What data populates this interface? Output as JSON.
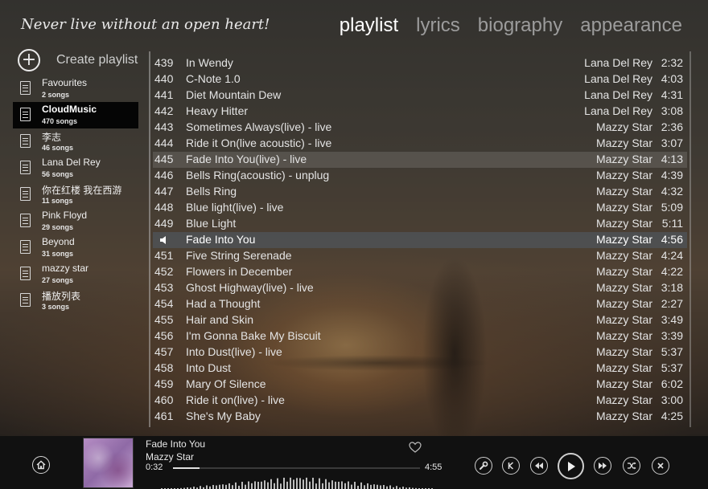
{
  "motto": "Never live without an open heart!",
  "tabs": [
    {
      "label": "playlist",
      "active": true
    },
    {
      "label": "lyrics",
      "active": false
    },
    {
      "label": "biography",
      "active": false
    },
    {
      "label": "appearance",
      "active": false
    }
  ],
  "create_playlist": "Create playlist",
  "playlists": [
    {
      "name": "Favourites",
      "count": "2 songs"
    },
    {
      "name": "CloudMusic",
      "count": "470 songs",
      "active": true
    },
    {
      "name": "李志",
      "count": "46 songs"
    },
    {
      "name": "Lana Del Rey",
      "count": "56 songs"
    },
    {
      "name": "你在红楼 我在西游",
      "count": "11 songs"
    },
    {
      "name": "Pink Floyd",
      "count": "29 songs"
    },
    {
      "name": "Beyond",
      "count": "31 songs"
    },
    {
      "name": "mazzy star",
      "count": "27 songs"
    },
    {
      "name": "播放列表",
      "count": "3 songs"
    }
  ],
  "tracks": [
    {
      "num": "439",
      "title": "In Wendy",
      "artist": "Lana Del Rey",
      "duration": "2:32"
    },
    {
      "num": "440",
      "title": "C-Note 1.0",
      "artist": "Lana Del Rey",
      "duration": "4:03"
    },
    {
      "num": "441",
      "title": "Diet Mountain Dew",
      "artist": "Lana Del Rey",
      "duration": "4:31"
    },
    {
      "num": "442",
      "title": "Heavy Hitter",
      "artist": "Lana Del Rey",
      "duration": "3:08"
    },
    {
      "num": "443",
      "title": "Sometimes Always(live) - live",
      "artist": "Mazzy Star",
      "duration": "2:36"
    },
    {
      "num": "444",
      "title": "Ride it On(live acoustic) - live",
      "artist": "Mazzy Star",
      "duration": "3:07"
    },
    {
      "num": "445",
      "title": "Fade Into You(live) - live",
      "artist": "Mazzy Star",
      "duration": "4:13",
      "selected": true
    },
    {
      "num": "446",
      "title": "Bells Ring(acoustic) - unplug",
      "artist": "Mazzy Star",
      "duration": "4:39"
    },
    {
      "num": "447",
      "title": "Bells Ring",
      "artist": "Mazzy Star",
      "duration": "4:32"
    },
    {
      "num": "448",
      "title": "Blue light(live) - live",
      "artist": "Mazzy Star",
      "duration": "5:09"
    },
    {
      "num": "449",
      "title": "Blue Light",
      "artist": "Mazzy Star",
      "duration": "5:11"
    },
    {
      "num": "",
      "title": "Fade Into You",
      "artist": "Mazzy Star",
      "duration": "4:56",
      "playing": true
    },
    {
      "num": "451",
      "title": "Five String Serenade",
      "artist": "Mazzy Star",
      "duration": "4:24"
    },
    {
      "num": "452",
      "title": "Flowers in December",
      "artist": "Mazzy Star",
      "duration": "4:22"
    },
    {
      "num": "453",
      "title": "Ghost Highway(live) - live",
      "artist": "Mazzy Star",
      "duration": "3:18"
    },
    {
      "num": "454",
      "title": "Had a Thought",
      "artist": "Mazzy Star",
      "duration": "2:27"
    },
    {
      "num": "455",
      "title": "Hair and Skin",
      "artist": "Mazzy Star",
      "duration": "3:49"
    },
    {
      "num": "456",
      "title": "I'm Gonna Bake My Biscuit",
      "artist": "Mazzy Star",
      "duration": "3:39"
    },
    {
      "num": "457",
      "title": "Into Dust(live) - live",
      "artist": "Mazzy Star",
      "duration": "5:37"
    },
    {
      "num": "458",
      "title": "Into Dust",
      "artist": "Mazzy Star",
      "duration": "5:37"
    },
    {
      "num": "459",
      "title": "Mary Of Silence",
      "artist": "Mazzy Star",
      "duration": "6:02"
    },
    {
      "num": "460",
      "title": "Ride it on(live) - live",
      "artist": "Mazzy Star",
      "duration": "3:00"
    },
    {
      "num": "461",
      "title": "She's My Baby",
      "artist": "Mazzy Star",
      "duration": "4:25"
    }
  ],
  "now_playing": {
    "title": "Fade Into You",
    "artist": "Mazzy Star",
    "current_time": "0:32",
    "total_time": "4:55",
    "progress": 0.108
  },
  "controls": [
    {
      "name": "settings-button",
      "icon": "wrench-icon"
    },
    {
      "name": "k-button",
      "icon": "k-icon"
    },
    {
      "name": "previous-button",
      "icon": "rewind-icon"
    },
    {
      "name": "play-button",
      "icon": "play-icon"
    },
    {
      "name": "next-button",
      "icon": "fast-forward-icon"
    },
    {
      "name": "shuffle-button",
      "icon": "shuffle-icon"
    },
    {
      "name": "close-button",
      "icon": "close-icon"
    }
  ],
  "colors": {
    "accent": "#ffffff",
    "panel": "#111111",
    "playing_row": "#505a64"
  }
}
